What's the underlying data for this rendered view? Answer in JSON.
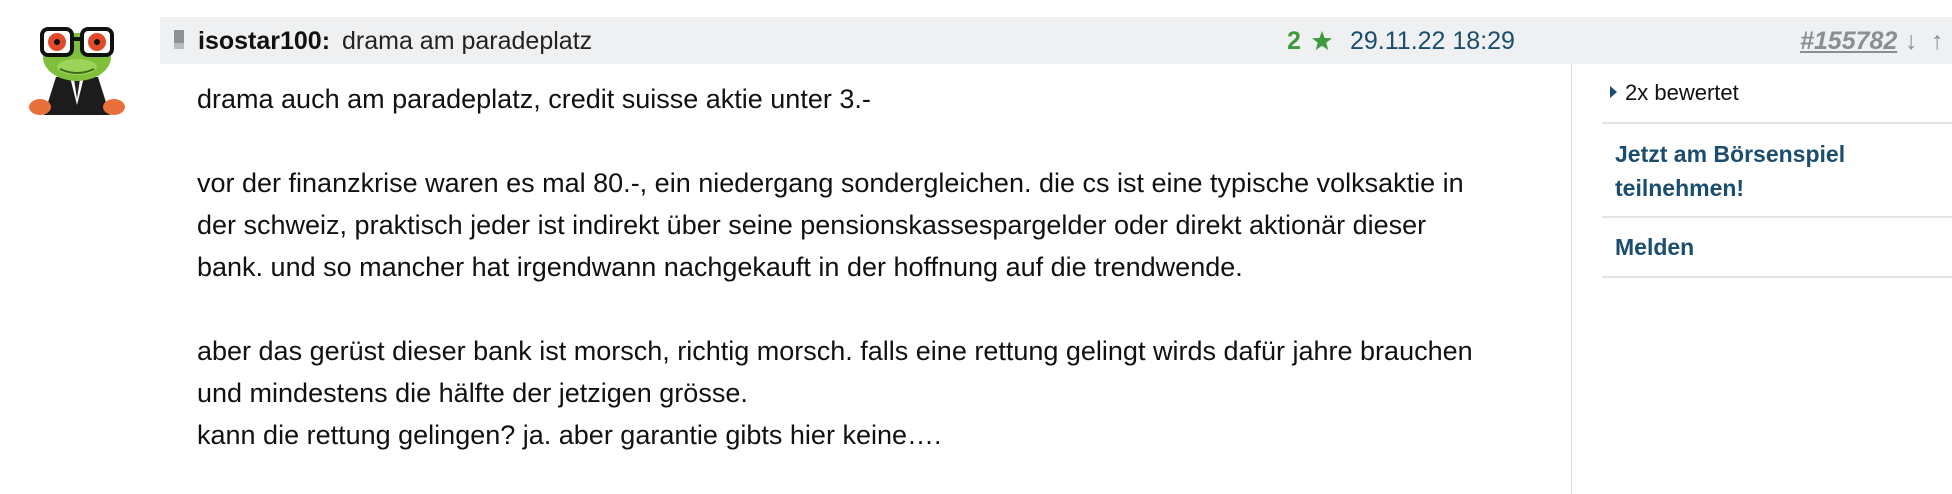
{
  "post": {
    "author": "isostar100:",
    "title": "drama am paradeplatz",
    "rating_count": "2",
    "timestamp": "29.11.22 18:29",
    "post_id": "#155782",
    "arrow_down": "↓",
    "arrow_up": "↑",
    "paragraphs": [
      "drama auch am paradeplatz, credit suisse aktie unter 3.-",
      "vor der finanzkrise waren es mal 80.-, ein niedergang sondergleichen. die cs ist eine typische volksaktie in der schweiz, praktisch jeder ist indirekt über seine pensionskassespargelder oder direkt aktionär dieser bank. und so mancher hat irgendwann nachgekauft in der hoffnung auf die trendwende.",
      "aber das gerüst dieser bank ist morsch, richtig morsch. falls eine rettung gelingt wirds dafür jahre brauchen und mindestens die hälfte der jetzigen grösse.\nkann die rettung gelingen? ja. aber garantie gibts hier keine…."
    ]
  },
  "sidebar": {
    "rated_label": "2x bewertet",
    "borsenspiel_label": "Jetzt am Börsenspiel teilnehmen!",
    "melden_label": "Melden"
  },
  "icons": {
    "avatar": "frog-avatar",
    "post": "post-icon",
    "star": "star-icon"
  },
  "colors": {
    "header_bg": "#eef0f1",
    "link": "#1a4d6e",
    "rating": "#3d9a3d",
    "muted": "#8b8f94"
  }
}
